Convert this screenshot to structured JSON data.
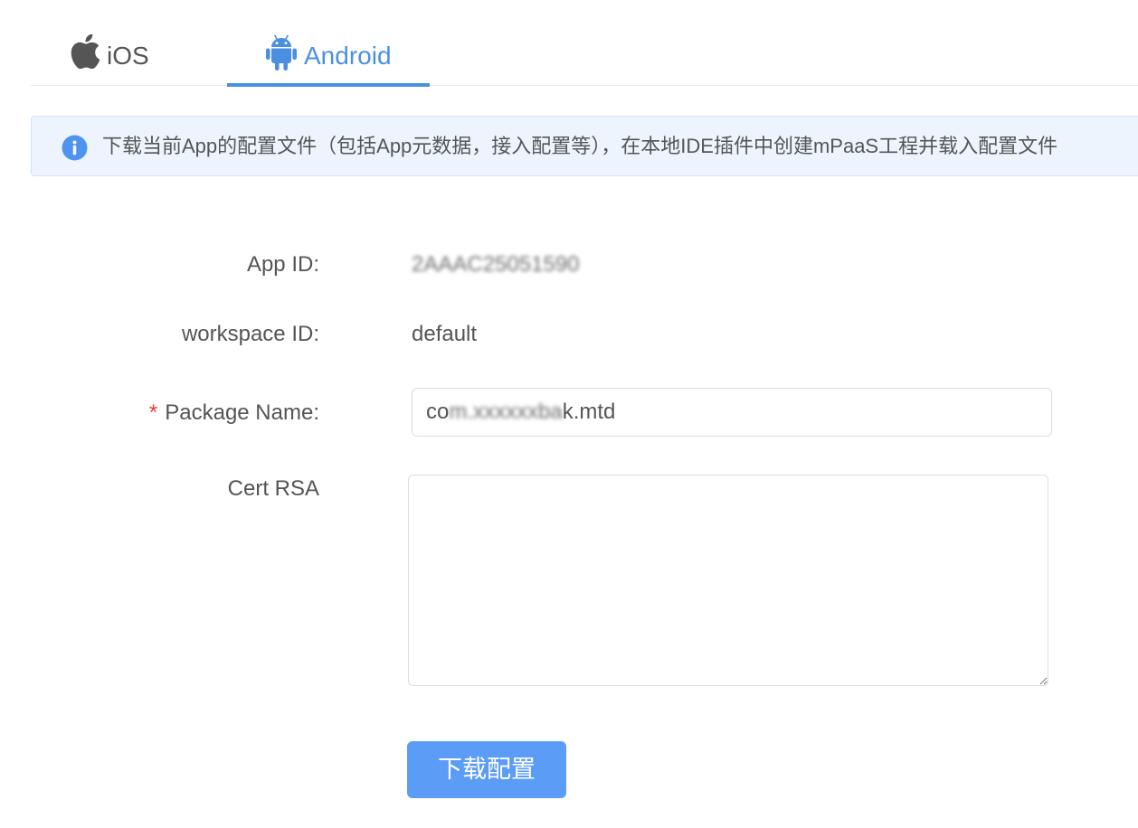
{
  "tabs": [
    {
      "label": "iOS",
      "icon": "apple-icon",
      "active": false
    },
    {
      "label": "Android",
      "icon": "android-icon",
      "active": true
    }
  ],
  "alert": {
    "icon": "info-icon",
    "text": "下载当前App的配置文件（包括App元数据，接入配置等），在本地IDE插件中创建mPaaS工程并载入配置文件"
  },
  "form": {
    "app_id": {
      "label": "App ID:",
      "value": "2AAAC25051590"
    },
    "workspace_id": {
      "label": "workspace ID:",
      "value": "default"
    },
    "package_name": {
      "required_mark": "*",
      "label": "Package Name:",
      "value_prefix": "co",
      "value_redacted": "m.xxxxxxba",
      "value_suffix": "k.mtd"
    },
    "cert_rsa": {
      "label": "Cert RSA",
      "value": ""
    }
  },
  "download_button": {
    "label": "下载配置"
  },
  "colors": {
    "accent": "#4a90e2",
    "button": "#5b9cf6",
    "alert_bg": "#edf4fe",
    "alert_border": "#d3e3fb",
    "required": "#e8393a",
    "text": "#555555"
  }
}
